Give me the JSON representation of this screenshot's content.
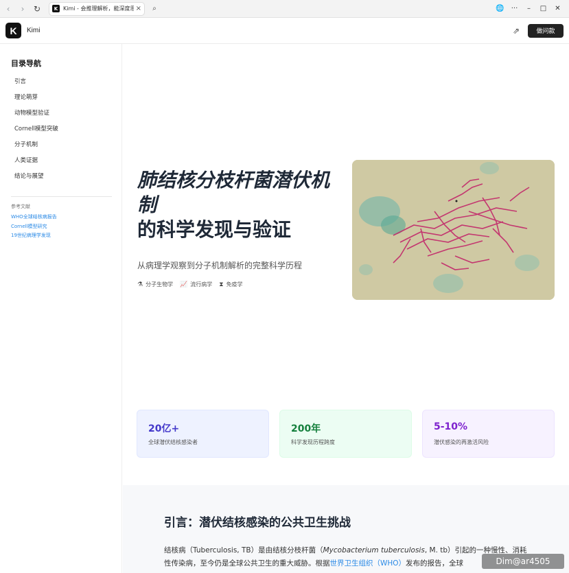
{
  "browser": {
    "tab_title": "Kimi - 会推理解析，能深度思考",
    "back_icon": "‹",
    "forward_icon": "›",
    "reload_icon": "↻",
    "close_icon": "×",
    "search_icon": "⌕",
    "globe_icon": "🌐",
    "more_icon": "···",
    "minimize_icon": "–",
    "maximize_icon": "□",
    "window_close_icon": "✕"
  },
  "header": {
    "logo_letter": "K",
    "app_name": "Kimi",
    "share_icon": "⇗",
    "ask_button": "做问款"
  },
  "sidebar": {
    "title": "目录导航",
    "items": [
      {
        "label": "引言"
      },
      {
        "label": "理论萌芽"
      },
      {
        "label": "动物模型验证"
      },
      {
        "label": "Cornell模型突破"
      },
      {
        "label": "分子机制"
      },
      {
        "label": "人类证据"
      },
      {
        "label": "结论与展望"
      }
    ],
    "refs_title": "参考文献",
    "refs": [
      {
        "label": "WHO全球结核病报告"
      },
      {
        "label": "Cornell模型研究"
      },
      {
        "label": "19世纪病理学发现"
      }
    ]
  },
  "hero": {
    "title_italic": "肺结核分枝杆菌潜伏机制",
    "title_rest": "的科学发现与验证",
    "subtitle": "从病理学观察到分子机制解析的完整科学历程",
    "tags": [
      {
        "icon": "⚗",
        "label": "分子生物学"
      },
      {
        "icon": "📈",
        "label": "流行病学"
      },
      {
        "icon": "⧗",
        "label": "免疫学"
      }
    ]
  },
  "stats": [
    {
      "value": "20亿+",
      "label": "全球潜伏结核感染者",
      "color": "#4338ca",
      "bg": "#eef2ff",
      "border": "#e0e7ff"
    },
    {
      "value": "200年",
      "label": "科学发现历程跨度",
      "color": "#15803d",
      "bg": "#ecfdf3",
      "border": "#dcfce7"
    },
    {
      "value": "5-10%",
      "label": "潜伏感染的再激活风险",
      "color": "#7e22ce",
      "bg": "#f7f2ff",
      "border": "#ede4ff"
    }
  ],
  "intro": {
    "title": "引言：潜伏结核感染的公共卫生挑战",
    "text_1": "结核病（Tuberculosis, TB）是由结核分枝杆菌（",
    "text_italic": "Mycobacterium tuberculosis",
    "text_2": ", M. tb）引起的一种慢性、消耗性传染病，至今仍是全球公共卫生的重大威胁。根据",
    "text_link": "世界卫生组织（WHO）",
    "text_3": "发布的报告，全球"
  },
  "watermark": "Dim@ar4505"
}
